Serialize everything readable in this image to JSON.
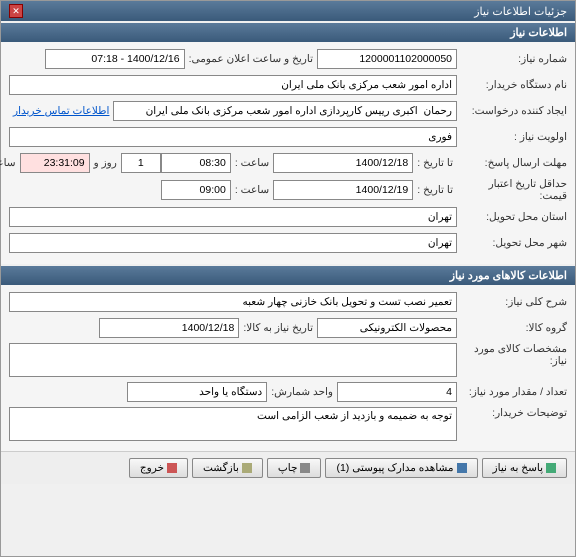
{
  "window_title": "جزئیات اطلاعات نیاز",
  "section1_title": "اطلاعات نیاز",
  "section2_title": "اطلاعات کالاهای مورد نیاز",
  "labels": {
    "need_no": "شماره نیاز:",
    "announce_dt": "تاریخ و ساعت اعلان عمومی:",
    "buyer_org": "نام دستگاه خریدار:",
    "request_creator": "ایجاد کننده درخواست:",
    "priority": "اولویت نیاز :",
    "reply_deadline": "مهلت ارسال پاسخ:",
    "to_date": "تا تاریخ :",
    "time": "ساعت :",
    "days_and": "روز و",
    "time_remaining": "ساعت باقی مانده",
    "price_validity": "حداقل تاریخ اعتبار قیمت:",
    "delivery_province": "استان محل تحویل:",
    "delivery_city": "شهر محل تحویل:",
    "need_desc": "شرح کلی نیاز:",
    "goods_group": "گروه کالا:",
    "need_date": "تاریخ نیاز به کالا:",
    "goods_spec": "مشخصات کالای مورد نیاز:",
    "qty": "تعداد / مقدار مورد نیاز:",
    "unit": "واحد شمارش:",
    "buyer_notes": "توضیحات خریدار:",
    "contact": "اطلاعات تماس خریدار"
  },
  "values": {
    "need_no": "1200001102000050",
    "announce_dt": "1400/12/16 - 07:18",
    "buyer_org": "اداره امور شعب مرکزی بانک ملی ایران",
    "request_creator": "رحمان  اکبری رییس کارپردازی اداره امور شعب مرکزی بانک ملی ایران",
    "priority": "فوری",
    "reply_to_date": "1400/12/18",
    "reply_time": "08:30",
    "days_left": "1",
    "time_left": "23:31:09",
    "price_to_date": "1400/12/19",
    "price_time": "09:00",
    "province": "تهران",
    "city": "تهران",
    "need_desc": "تعمیر نصب تست و تحویل بانک خازنی چهار شعبه",
    "goods_group": "محصولات الکترونیکی",
    "need_date": "1400/12/18",
    "goods_spec": "",
    "qty": "4",
    "unit": "دستگاه یا واحد",
    "buyer_notes": "توجه به ضمیمه و بازدید از شعب الزامی است"
  },
  "buttons": {
    "reply": "پاسخ به نیاز",
    "attachments": "مشاهده مدارک پیوستی (1)",
    "print": "چاپ",
    "back": "بازگشت",
    "exit": "خروج"
  }
}
